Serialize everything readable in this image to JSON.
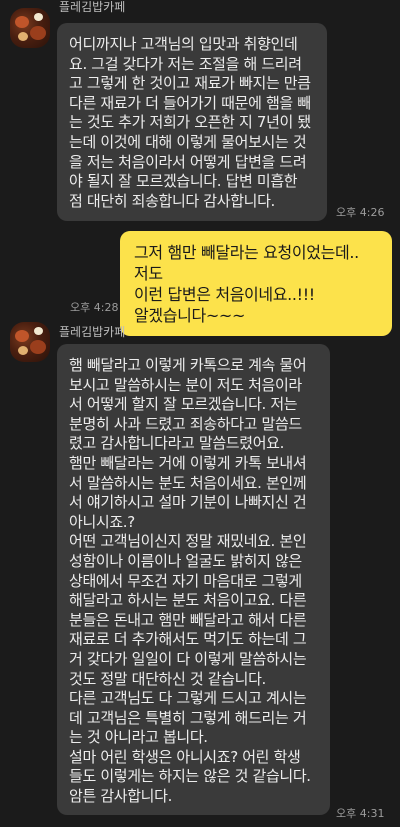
{
  "chat": {
    "messages": [
      {
        "direction": "incoming",
        "sender": "플레김밥카페",
        "text": "어디까지나 고객님의 입맛과 취향인데\n요. 그걸 갖다가 저는 조절을 해 드리려\n고 그렇게 한 것이고 재료가 빠지는 만큼\n다른 재료가 더 들어가기 때문에 햄을 빼\n는 것도 추가 저희가 오픈한 지 7년이 됐\n는데 이것에 대해 이렇게 물어보시는 것\n을 저는 처음이라서 어떻게 답변을 드려\n야 될지 잘 모르겠습니다. 답변 미흡한\n점 대단히 죄송합니다 감사합니다.",
        "time": "오후 4:26"
      },
      {
        "direction": "outgoing",
        "text": "그저 햄만 빼달라는 요청이었는데..저도\n이런 답변은 처음이네요..!!!\n알겠습니다~~~",
        "time": "오후 4:28"
      },
      {
        "direction": "incoming",
        "sender": "플레김밥카페",
        "text": "햄 빼달라고 이렇게 카톡으로 계속 물어\n보시고 말씀하시는 분이 저도 처음이라\n서 어떻게 할지 잘 모르겠습니다. 저는\n분명히 사과 드렸고 죄송하다고 말씀드\n렸고 감사합니다라고 말씀드렸어요.\n햄만 빼달라는 거에 이렇게 카톡 보내셔\n서 말씀하시는 분도 처음이세요. 본인께\n서 얘기하시고 설마 기분이 나빠지신 건\n아니시죠.?\n어떤 고객님이신지 정말 재밌네요. 본인\n성함이나 이름이나 얼굴도 밝히지 않은\n상태에서 무조건 자기 마음대로 그렇게\n해달라고 하시는 분도 처음이고요. 다른\n분들은 돈내고 햄만 빼달라고 해서 다른\n재료로 더 추가해서도 먹기도 하는데 그\n거 갖다가 일일이 다 이렇게 말씀하시는\n것도 정말 대단하신 것 같습니다.\n다른 고객님도 다 그렇게 드시고 계시는\n데 고객님은 특별히 그렇게 해드리는 거\n는 것 아니라고 봅니다.\n설마 어린 학생은 아니시죠? 어린 학생\n들도 이렇게는 하지는 않은 것 같습니다.\n암튼 감사합니다.",
        "time": "오후 4:31"
      }
    ]
  }
}
